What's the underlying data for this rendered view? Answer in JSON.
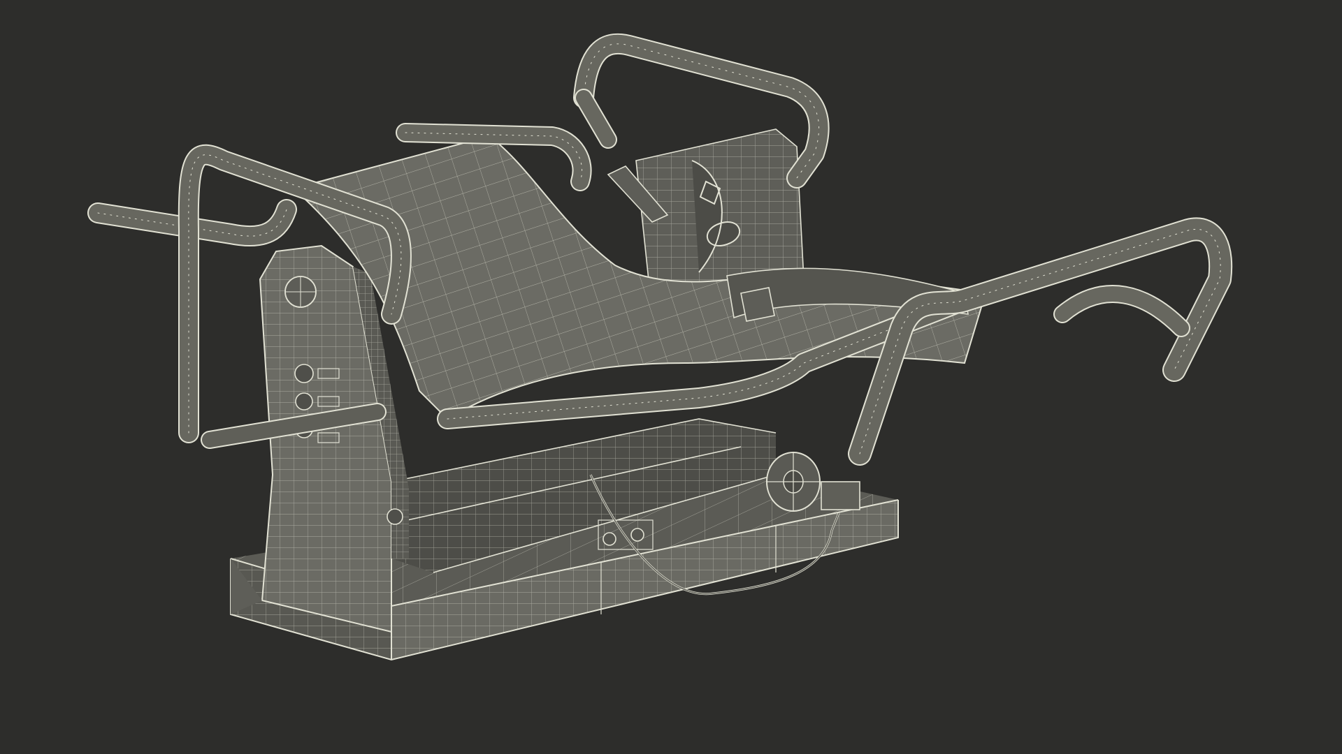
{
  "scene": {
    "subject": "wireframe-seat-frame-3d-model",
    "background_color": "#2d2d2b",
    "surface_color": "#66665f",
    "surface_dark": "#4a4a45",
    "wire_color": "#e2e2d4",
    "shade_color": "#3a3a36",
    "icon_names": [
      "tube-frame",
      "seat-sheet",
      "support-plate",
      "base-box",
      "control-knob",
      "wheel",
      "cable"
    ]
  }
}
